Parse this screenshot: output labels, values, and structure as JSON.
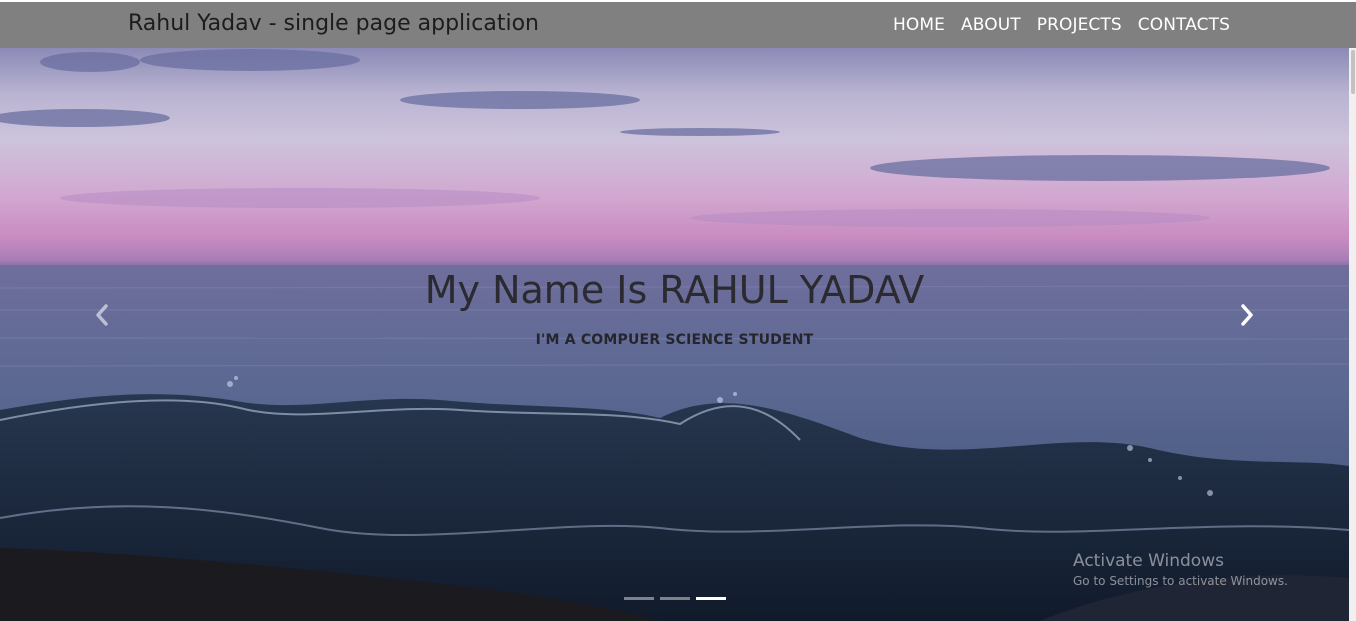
{
  "navbar": {
    "brand": "Rahul Yadav - single page application",
    "links": [
      {
        "label": "HOME"
      },
      {
        "label": "ABOUT"
      },
      {
        "label": "PROJECTS"
      },
      {
        "label": "CONTACTS"
      }
    ]
  },
  "hero": {
    "heading": "My Name Is RAHUL YADAV",
    "subheading": "I'M A COMPUER SCIENCE STUDENT",
    "indicators_count": 3,
    "active_indicator": 3
  },
  "watermark": {
    "title": "Activate Windows",
    "subtitle": "Go to Settings to activate Windows."
  },
  "icons": {
    "prev": "chevron-left-icon",
    "next": "chevron-right-icon"
  },
  "colors": {
    "navbar_bg": "#808080",
    "nav_text": "#ffffff",
    "brand_text": "#1c1c1c",
    "heading_text": "#2a2a30"
  }
}
